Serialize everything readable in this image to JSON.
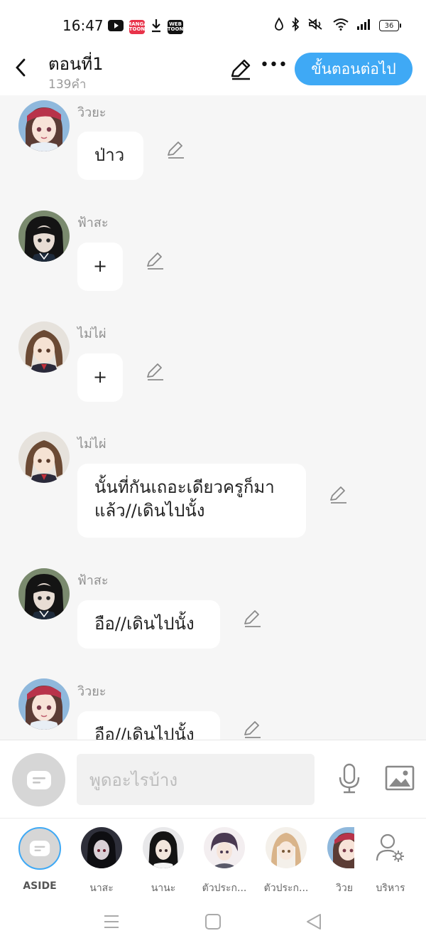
{
  "status_bar": {
    "time": "16:47",
    "app_badges": [
      "MANGA TOON",
      "WEB TOON"
    ],
    "battery": "36"
  },
  "header": {
    "title": "ตอนที่1",
    "word_count": "139คำ",
    "next_button": "ขั้นตอนต่อไป",
    "more_label": "•••"
  },
  "messages": [
    {
      "speaker": "วิวยะ",
      "text": "ป่าว"
    },
    {
      "speaker": "ฟ้าสะ",
      "text": "+"
    },
    {
      "speaker": "ไม่ไผ่",
      "text": "+"
    },
    {
      "speaker": "ไม่ไผ่",
      "text": "นั้นที่กันเถอะเดียวครูก็มา\nแล้ว//เดินไปนั้ง"
    },
    {
      "speaker": "ฟ้าสะ",
      "text": "อือ//เดินไปนั้ง"
    },
    {
      "speaker": "วิวยะ",
      "text": "อือ//เดินไปนั้ง"
    }
  ],
  "input": {
    "placeholder": "พูดอะไรบ้าง"
  },
  "characters": [
    {
      "label": "ASIDE"
    },
    {
      "label": "นาสะ"
    },
    {
      "label": "นานะ"
    },
    {
      "label": "ตัวประก..."
    },
    {
      "label": "ตัวประก..."
    },
    {
      "label": "วิวย"
    },
    {
      "label": "บริหาร"
    }
  ],
  "colors": {
    "accent": "#3fa9f5",
    "background": "#f6f6f6",
    "bubble": "#ffffff",
    "muted_text": "#8f8f8f"
  }
}
